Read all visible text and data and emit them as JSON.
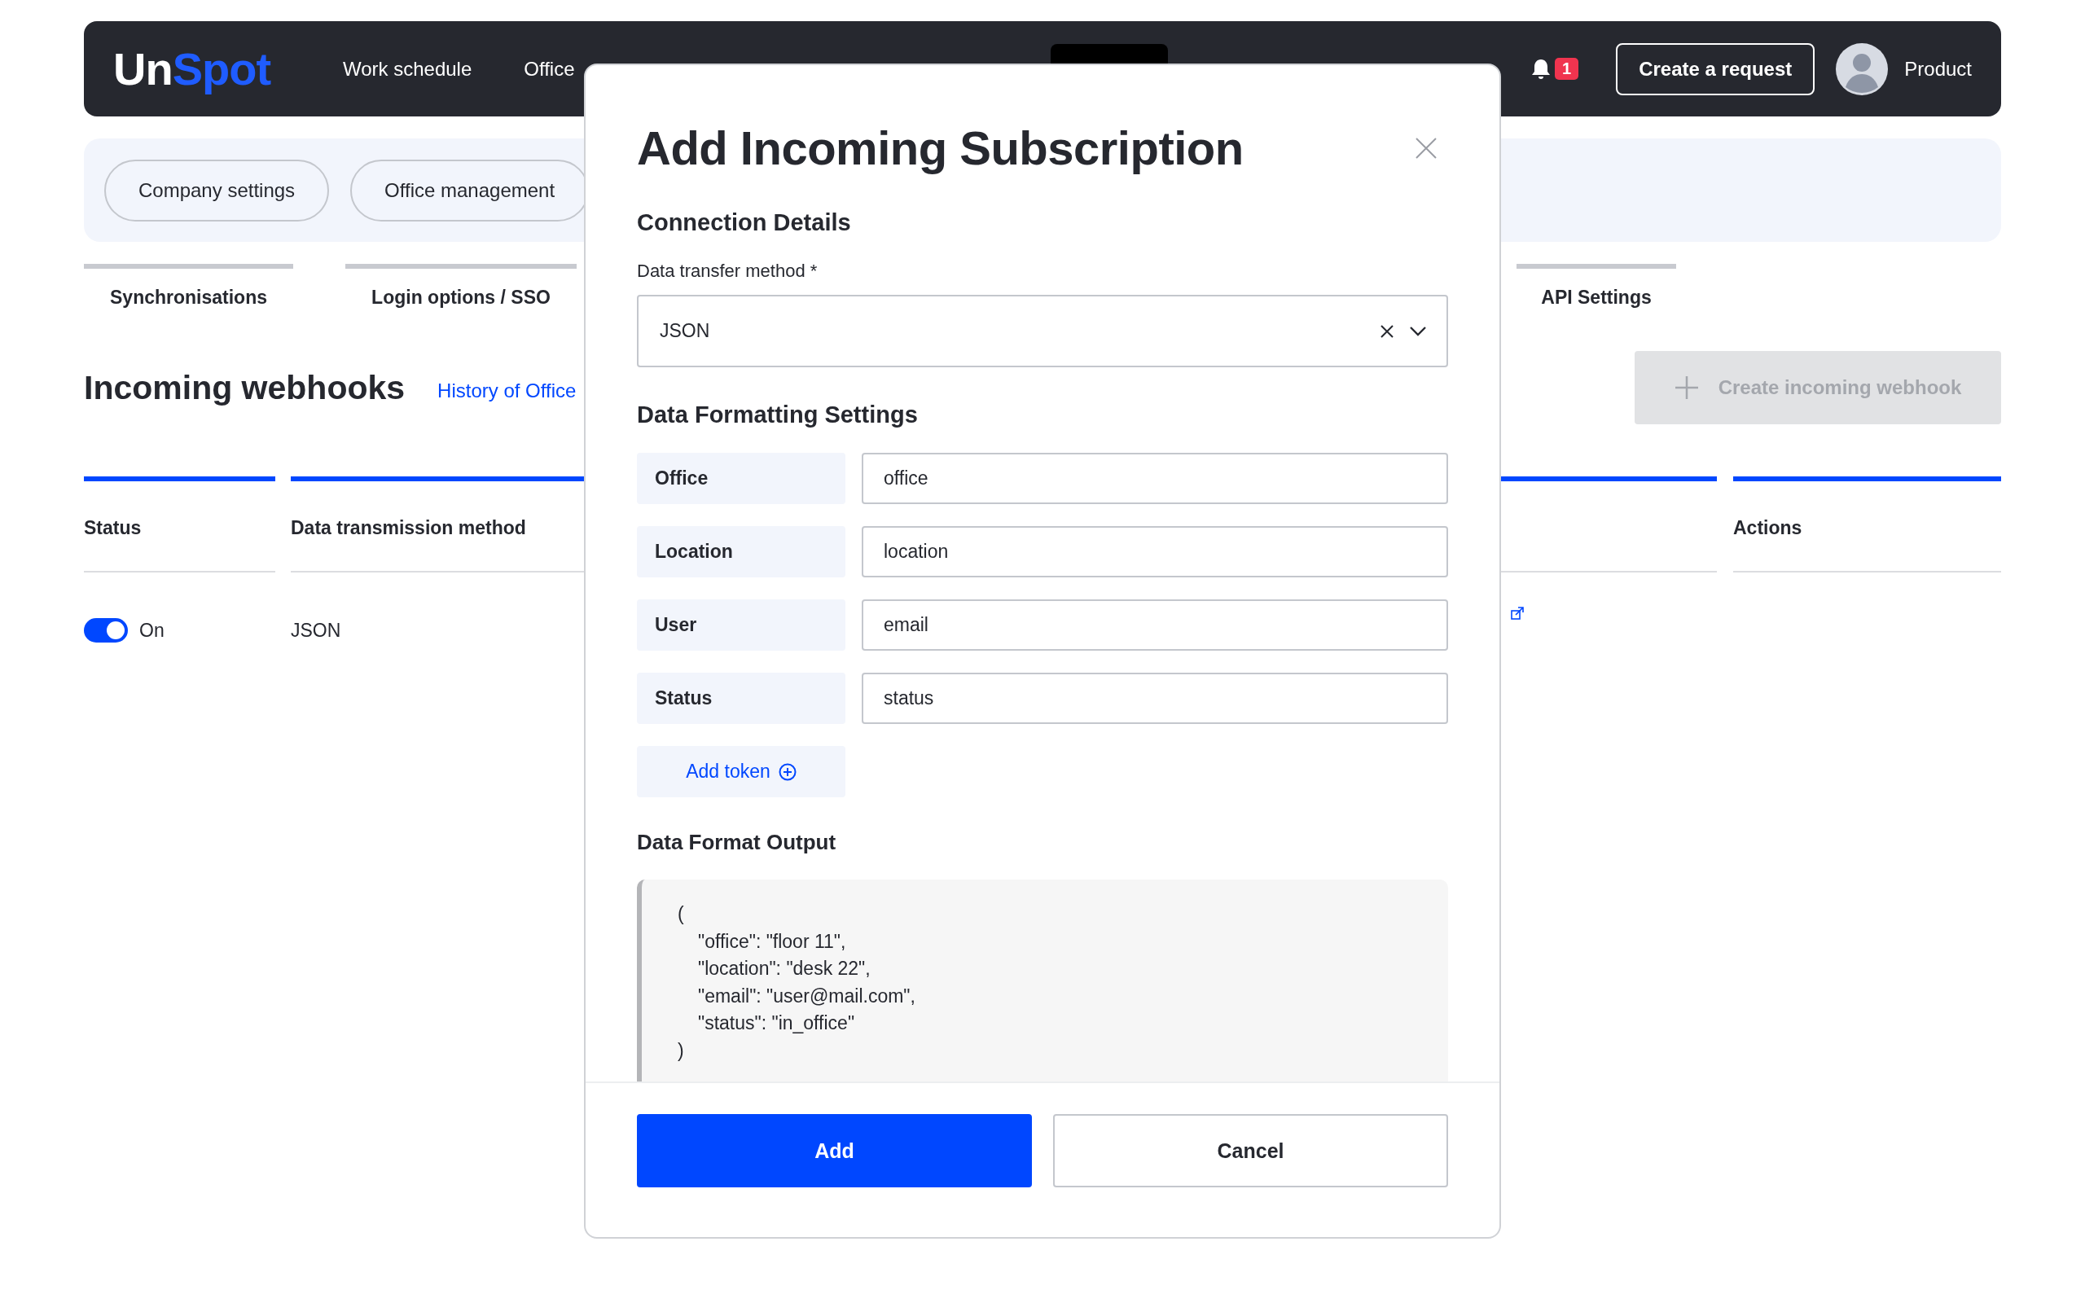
{
  "header": {
    "logo": {
      "first": "Un",
      "second": "Spot"
    },
    "nav": [
      {
        "label": "Work schedule",
        "selected": false
      },
      {
        "label": "Office",
        "selected": false
      },
      {
        "selected": true
      }
    ],
    "notifications": "1",
    "create_button": "Create a request",
    "user": "Product"
  },
  "subnav": [
    "Company settings",
    "Office management"
  ],
  "tabs": [
    "Synchronisations",
    "Login options / SSO",
    "API Settings"
  ],
  "page": {
    "title": "Incoming webhooks",
    "link": "History of Office",
    "create_button": {
      "label": "Create incoming webhook",
      "disabled": true
    }
  },
  "table": {
    "columns": [
      "Status",
      "Data transmission method",
      "Actions"
    ],
    "rows": [
      {
        "on": true,
        "status": "On",
        "method": "JSON"
      }
    ]
  },
  "modal": {
    "title": "Add Incoming Subscription",
    "section_connection": "Connection Details",
    "method_label": "Data transfer method *",
    "method_value": "JSON",
    "section_formatting": "Data Formatting Settings",
    "tokens": [
      {
        "label": "Office",
        "value": "office"
      },
      {
        "label": "Location",
        "value": "location"
      },
      {
        "label": "User",
        "value": "email"
      },
      {
        "label": "Status",
        "value": "status"
      }
    ],
    "add_token": "Add token",
    "section_output": "Data Format Output",
    "output_lines": [
      {
        "text": "(",
        "indented": false
      },
      {
        "text": "\"office\": \"floor 11\",",
        "indented": true
      },
      {
        "text": "\"location\": \"desk 22\",",
        "indented": true
      },
      {
        "text": "\"email\": \"user@mail.com\",",
        "indented": true
      },
      {
        "text": "\"status\": \"in_office\"",
        "indented": true
      },
      {
        "text": ")",
        "indented": false
      }
    ],
    "buttons": [
      {
        "label": "Add",
        "kind": "primary"
      },
      {
        "label": "Cancel",
        "kind": "secondary"
      }
    ]
  }
}
